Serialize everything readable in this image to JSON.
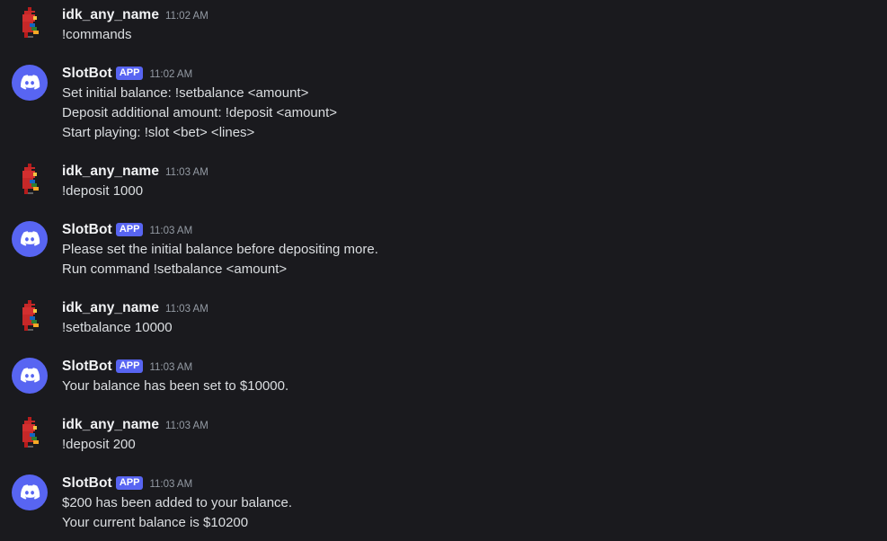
{
  "colors": {
    "background": "#1a1a1e",
    "text": "#dbdee1",
    "username": "#f2f3f5",
    "timestamp": "#949ba4",
    "app_tag": "#5865f2",
    "bot_avatar": "#5865f2"
  },
  "messages": [
    {
      "author": "idk_any_name",
      "is_bot": false,
      "avatar_icon": "red-parrot-pixel-avatar-icon",
      "time": "11:02 AM",
      "lines": [
        "!commands"
      ]
    },
    {
      "author": "SlotBot",
      "is_bot": true,
      "tag": "APP",
      "avatar_icon": "discord-logo-icon",
      "time": "11:02 AM",
      "lines": [
        "Set initial balance: !setbalance <amount>",
        "Deposit additional amount: !deposit <amount>",
        "Start playing: !slot <bet> <lines>"
      ]
    },
    {
      "author": "idk_any_name",
      "is_bot": false,
      "avatar_icon": "red-parrot-pixel-avatar-icon",
      "time": "11:03 AM",
      "lines": [
        "!deposit 1000"
      ]
    },
    {
      "author": "SlotBot",
      "is_bot": true,
      "tag": "APP",
      "avatar_icon": "discord-logo-icon",
      "time": "11:03 AM",
      "lines": [
        "Please set the initial balance before depositing more.",
        "Run command !setbalance <amount>"
      ]
    },
    {
      "author": "idk_any_name",
      "is_bot": false,
      "avatar_icon": "red-parrot-pixel-avatar-icon",
      "time": "11:03 AM",
      "lines": [
        "!setbalance 10000"
      ]
    },
    {
      "author": "SlotBot",
      "is_bot": true,
      "tag": "APP",
      "avatar_icon": "discord-logo-icon",
      "time": "11:03 AM",
      "lines": [
        "Your balance has been set to $10000."
      ]
    },
    {
      "author": "idk_any_name",
      "is_bot": false,
      "avatar_icon": "red-parrot-pixel-avatar-icon",
      "time": "11:03 AM",
      "lines": [
        "!deposit 200"
      ]
    },
    {
      "author": "SlotBot",
      "is_bot": true,
      "tag": "APP",
      "avatar_icon": "discord-logo-icon",
      "time": "11:03 AM",
      "lines": [
        "$200 has been added to your balance.",
        "Your current balance is $10200"
      ]
    }
  ]
}
